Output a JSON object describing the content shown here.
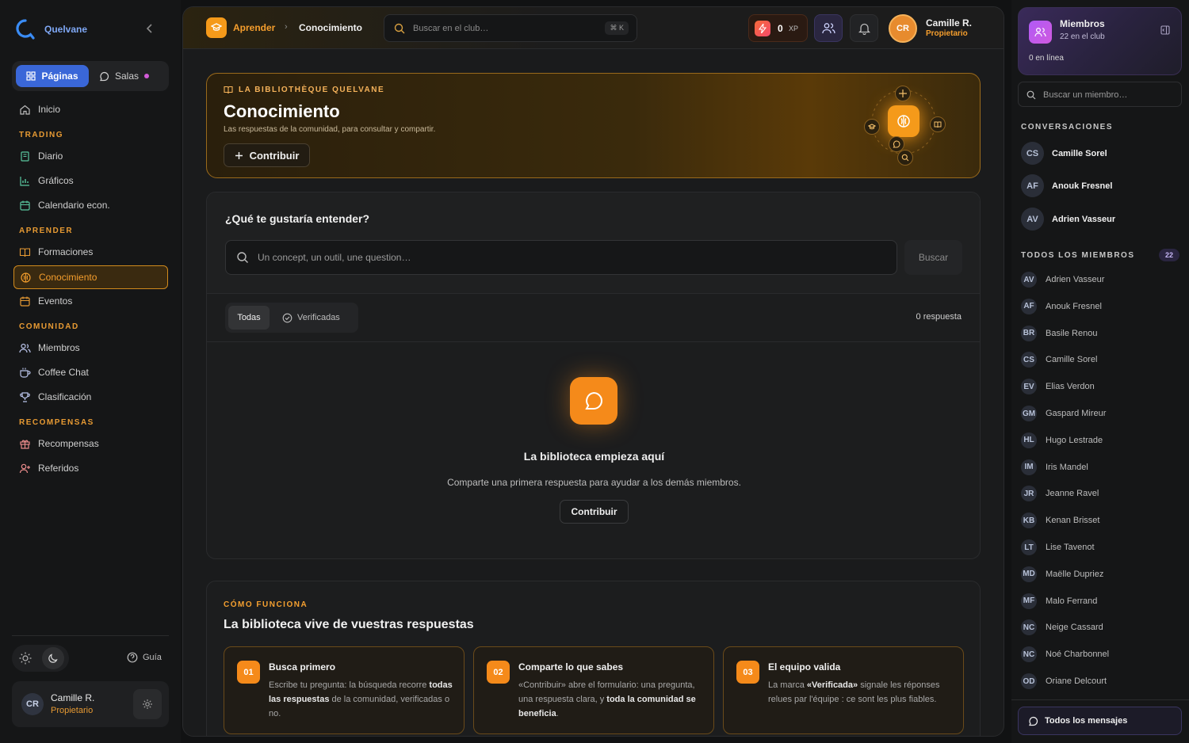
{
  "app": {
    "name": "Quelvane"
  },
  "sidebar": {
    "tabs": {
      "pages": "Páginas",
      "rooms": "Salas"
    },
    "home": "Inicio",
    "sections": [
      {
        "title": "TRADING",
        "items": [
          "Diario",
          "Gráficos",
          "Calendario econ."
        ]
      },
      {
        "title": "APRENDER",
        "items": [
          "Formaciones",
          "Conocimiento",
          "Eventos"
        ]
      },
      {
        "title": "COMUNIDAD",
        "items": [
          "Miembros",
          "Coffee Chat",
          "Clasificación"
        ]
      },
      {
        "title": "RECOMPENSAS",
        "items": [
          "Recompensas",
          "Referidos"
        ]
      }
    ],
    "active_item": "Conocimiento",
    "guide": "Guía",
    "user": {
      "initials": "CR",
      "name": "Camille R.",
      "role": "Propietario"
    }
  },
  "topbar": {
    "breadcrumb": [
      "Aprender",
      "Conocimiento"
    ],
    "search_placeholder": "Buscar en el club…",
    "shortcut": "⌘ K",
    "xp_value": "0",
    "xp_label": "XP",
    "user": {
      "initials": "CR",
      "name": "Camille R.",
      "role": "Propietario"
    }
  },
  "hero": {
    "eyebrow": "LA BIBLIOTHÈQUE QUELVANE",
    "title": "Conocimiento",
    "subtitle": "Las respuestas de la comunidad, para consultar y compartir.",
    "contribute": "Contribuir"
  },
  "search_card": {
    "title": "¿Qué te gustaría entender?",
    "placeholder": "Un concept, un outil, une question…",
    "button": "Buscar",
    "filters": {
      "all": "Todas",
      "verified": "Verificadas"
    },
    "answers_count": "0 respuesta",
    "empty": {
      "title": "La biblioteca empieza aquí",
      "subtitle": "Comparte una primera respuesta para ayudar a los demás miembros.",
      "button": "Contribuir"
    }
  },
  "how": {
    "eyebrow": "CÓMO FUNCIONA",
    "title": "La biblioteca vive de vuestras respuestas",
    "steps": [
      {
        "num": "01",
        "title": "Busca primero",
        "text_a": "Escribe tu pregunta: la búsqueda recorre ",
        "bold": "todas las respuestas",
        "text_b": " de la comunidad, verificadas o no."
      },
      {
        "num": "02",
        "title": "Comparte lo que sabes",
        "text_a": "«Contribuir» abre el formulario: una pregunta, una respuesta clara, y ",
        "bold": "toda la comunidad se beneficia",
        "text_b": "."
      },
      {
        "num": "03",
        "title": "El equipo valida",
        "text_a": "La marca ",
        "bold": "«Verificada»",
        "text_b": " signale les réponses relues par l'équipe : ce sont les plus fiables."
      }
    ]
  },
  "right": {
    "members_title": "Miembros",
    "members_sub": "22 en el club",
    "online": "0 en línea",
    "search_placeholder": "Buscar un miembro…",
    "conversations_title": "CONVERSACIONES",
    "conversations": [
      {
        "initials": "CS",
        "name": "Camille Sorel"
      },
      {
        "initials": "AF",
        "name": "Anouk Fresnel"
      },
      {
        "initials": "AV",
        "name": "Adrien Vasseur"
      }
    ],
    "all_members_title": "TODOS LOS MIEMBROS",
    "all_members_count": "22",
    "members": [
      {
        "initials": "AV",
        "name": "Adrien Vasseur"
      },
      {
        "initials": "AF",
        "name": "Anouk Fresnel"
      },
      {
        "initials": "BR",
        "name": "Basile Renou"
      },
      {
        "initials": "CS",
        "name": "Camille Sorel"
      },
      {
        "initials": "EV",
        "name": "Elias Verdon"
      },
      {
        "initials": "GM",
        "name": "Gaspard Mireur"
      },
      {
        "initials": "HL",
        "name": "Hugo Lestrade"
      },
      {
        "initials": "IM",
        "name": "Iris Mandel"
      },
      {
        "initials": "JR",
        "name": "Jeanne Ravel"
      },
      {
        "initials": "KB",
        "name": "Kenan Brisset"
      },
      {
        "initials": "LT",
        "name": "Lise Tavenot"
      },
      {
        "initials": "MD",
        "name": "Maëlle Dupriez"
      },
      {
        "initials": "MF",
        "name": "Malo Ferrand"
      },
      {
        "initials": "NC",
        "name": "Neige Cassard"
      },
      {
        "initials": "NC",
        "name": "Noé Charbonnel"
      },
      {
        "initials": "OD",
        "name": "Oriane Delcourt"
      }
    ],
    "all_messages": "Todos los mensajes"
  },
  "colors": {
    "accent": "#f59a1a",
    "primary": "#3a67d8",
    "purple": "#b05af5"
  }
}
